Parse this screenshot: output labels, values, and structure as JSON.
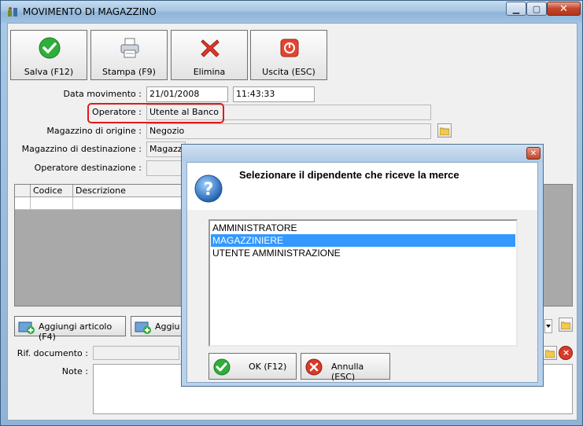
{
  "window": {
    "title": "MOVIMENTO DI MAGAZZINO"
  },
  "titlebar": {
    "minimize_glyph": "▁",
    "maximize_glyph": "▢",
    "close_glyph": "✕"
  },
  "toolbar": {
    "save_label": "Salva (F12)",
    "print_label": "Stampa (F9)",
    "delete_label": "Elimina",
    "exit_label": "Uscita (ESC)"
  },
  "form": {
    "date_label": "Data movimento :",
    "date_value": "21/01/2008",
    "time_value": "11:43:33",
    "operator_label": "Operatore :",
    "operator_value": "Utente al Banco",
    "origin_label": "Magazzino di origine :",
    "origin_value": "Negozio",
    "dest_label": "Magazzino di destinazione :",
    "dest_value": "Magazzin",
    "dest_operator_label": "Operatore destinazione :",
    "dest_operator_value": ""
  },
  "grid": {
    "columns": [
      "Codice",
      "Descrizione"
    ]
  },
  "actions": {
    "add_item_label": "Aggiungi articolo (F4)",
    "add_item2_label": "Aggiu"
  },
  "footer": {
    "doc_ref_label": "Rif. documento :",
    "notes_label": "Note :"
  },
  "dialog": {
    "close_glyph": "✕",
    "message": "Selezionare il dipendente che riceve la merce",
    "items": [
      "AMMINISTRATORE",
      "MAGAZZINIERE",
      "UTENTE AMMINISTRAZIONE"
    ],
    "selected_index": 1,
    "ok_label": "OK (F12)",
    "cancel_label": "Annulla (ESC)"
  },
  "colors": {
    "highlight": "#e01a1a",
    "selection": "#3399ff"
  },
  "icons": [
    "app-icon",
    "check-icon",
    "printer-icon",
    "x-icon",
    "power-icon",
    "folder-icon",
    "add-item-icon",
    "question-icon",
    "cancel-icon"
  ]
}
